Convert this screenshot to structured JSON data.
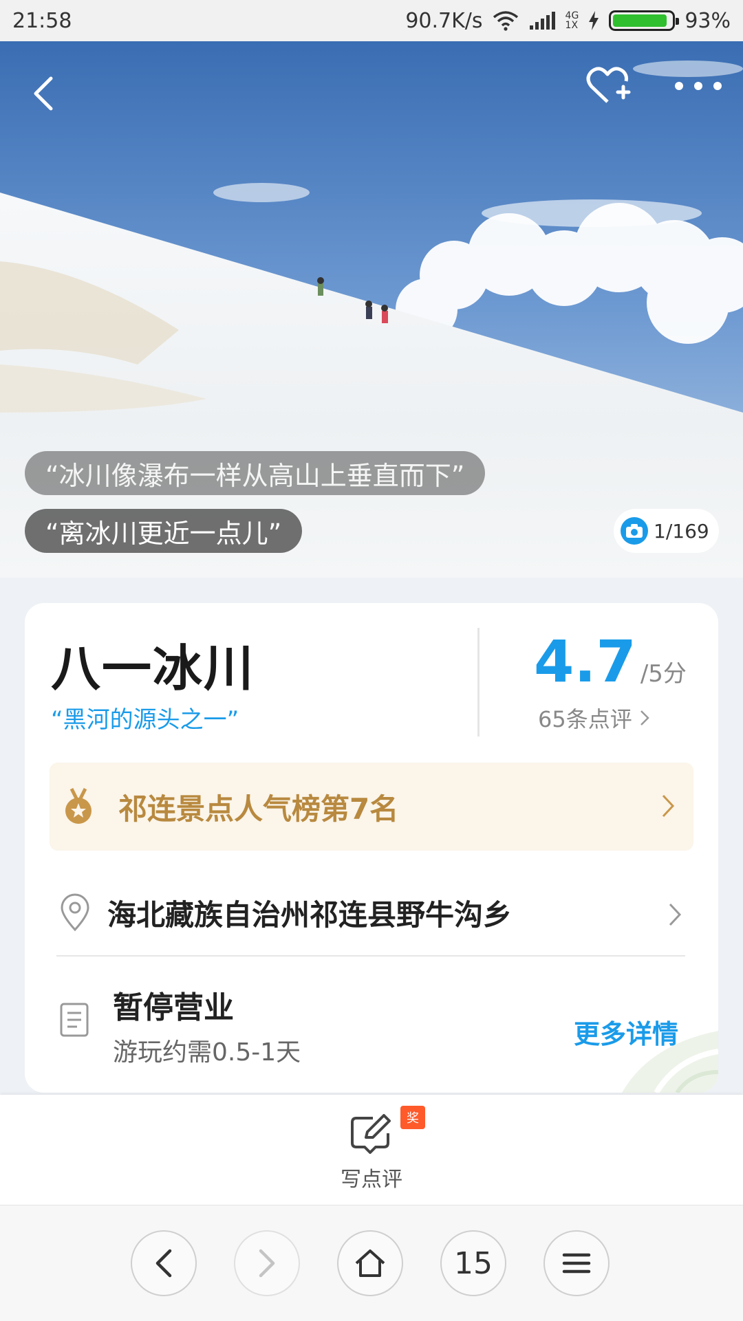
{
  "status_bar": {
    "time": "21:58",
    "network_speed": "90.7K/s",
    "network_type_top": "4G",
    "network_type_bottom": "1X",
    "battery_percent": "93%",
    "battery_level": 0.93,
    "icons": [
      "wifi-icon",
      "signal-icon",
      "charging-icon",
      "battery-icon"
    ]
  },
  "hero": {
    "quotes": [
      "“冰川像瀑布一样从高山上垂直而下”",
      "“离冰川更近一点儿”"
    ],
    "photo_counter": "1/169",
    "icons": [
      "back-icon",
      "favorite-add-icon",
      "more-icon",
      "camera-icon"
    ]
  },
  "info": {
    "title": "八一冰川",
    "subtitle": "“黑河的源头之一”",
    "rating": "4.7",
    "rating_max": "/5分",
    "review_count": "65条点评",
    "rank": "祁连景点人气榜第7名",
    "address": "海北藏族自治州祁连县野牛沟乡",
    "status": "暂停营业",
    "duration": "游玩约需0.5-1天",
    "more_details": "更多详情"
  },
  "review_bar": {
    "label": "写点评",
    "badge": "奖"
  },
  "browser_nav": {
    "tab_count": "15",
    "icons": [
      "back-arrow-icon",
      "forward-arrow-icon",
      "home-icon",
      "menu-icon"
    ]
  },
  "colors": {
    "accent": "#1a9be9",
    "gold": "#b8893f",
    "badge": "#ff5a2a"
  }
}
